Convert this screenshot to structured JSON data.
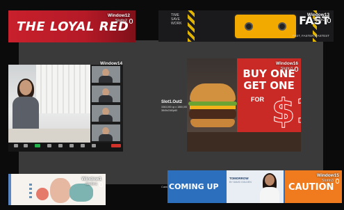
{
  "slot": {
    "label": "Slot1.Out2",
    "line1": "3363,000 op x 1860,000 op",
    "line2": "3840x2160p60",
    "bottom_tag": "Cable"
  },
  "windows": [
    {
      "id": "w12",
      "name": "Window12",
      "sub": "SlotIn2",
      "content": "THE LOYAL RED"
    },
    {
      "id": "w13",
      "name": "Window13",
      "sub": "SlotIn3",
      "content_big": "FAST",
      "content_sub": "FAST, FASTER, FASTEST",
      "brand": "TIME SAVE WORK"
    },
    {
      "id": "w14",
      "name": "Window14",
      "sub": ""
    },
    {
      "id": "w16",
      "name": "Window16",
      "sub": "SlotIn3",
      "buy": "BUY ONE GET ONE",
      "for": "FOR",
      "price": "$1"
    },
    {
      "id": "w1",
      "name": "Window1",
      "sub": "SlotIn1"
    },
    {
      "id": "w15",
      "name": "Window15",
      "sub": "SlotIn3",
      "coming": "COMING UP",
      "tomorrow": "TOMORROW",
      "tomorrow_sub": "BY DAVID GOLDEN",
      "caution": "CAUTION"
    }
  ],
  "colors": {
    "background": "#0b0b0b",
    "slot_bg": "#3a3a3a",
    "loyal_red": "#c8202c",
    "accent_orange": "#f07a1e",
    "accent_blue": "#2b6fbd"
  }
}
